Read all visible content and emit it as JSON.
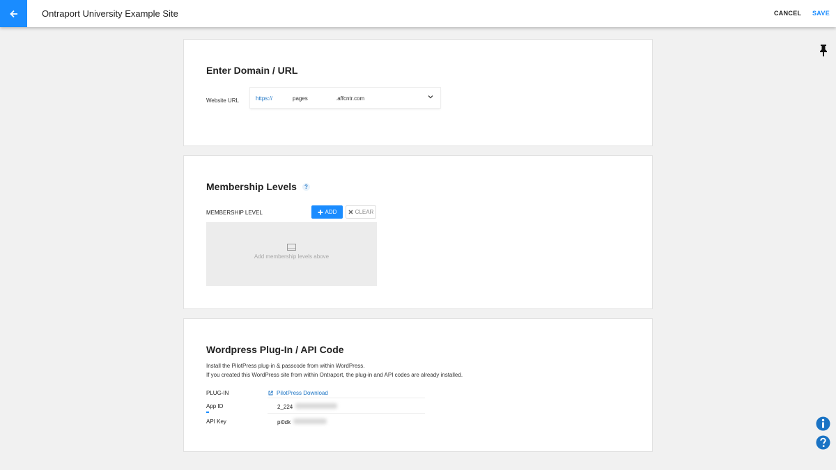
{
  "header": {
    "title": "Ontraport University Example Site",
    "cancel_label": "CANCEL",
    "save_label": "SAVE"
  },
  "domain_section": {
    "title": "Enter Domain / URL",
    "url_label": "Website URL",
    "protocol": "https://",
    "subdomain": "pages",
    "domain": ".affcntr.com"
  },
  "membership_section": {
    "title": "Membership Levels",
    "help": "?",
    "level_label": "MEMBERSHIP LEVEL",
    "add_label": "ADD",
    "clear_label": "CLEAR",
    "empty_text": "Add membership levels above"
  },
  "plugin_section": {
    "title": "Wordpress Plug-In / API Code",
    "desc_line1": "Install the PilotPress plug-in & passcode from within WordPress.",
    "desc_line2": "If you created this WordPress site from within Ontraport, the plug-in and API codes are already installed.",
    "plugin_label": "PLUG-IN",
    "plugin_link": "PilotPress Download",
    "app_id_label": "App ID",
    "app_id_value": "2_224",
    "api_key_label": "API Key",
    "api_key_value": "pi0dk"
  },
  "colors": {
    "accent": "#1a8cff",
    "link": "#1a73c4",
    "background": "#f1f1f1"
  },
  "icons": [
    "arrow-left-icon",
    "chevron-down-icon",
    "plus-icon",
    "close-icon",
    "empty-box-icon",
    "external-link-icon",
    "pin-icon",
    "info-icon",
    "help-icon"
  ]
}
